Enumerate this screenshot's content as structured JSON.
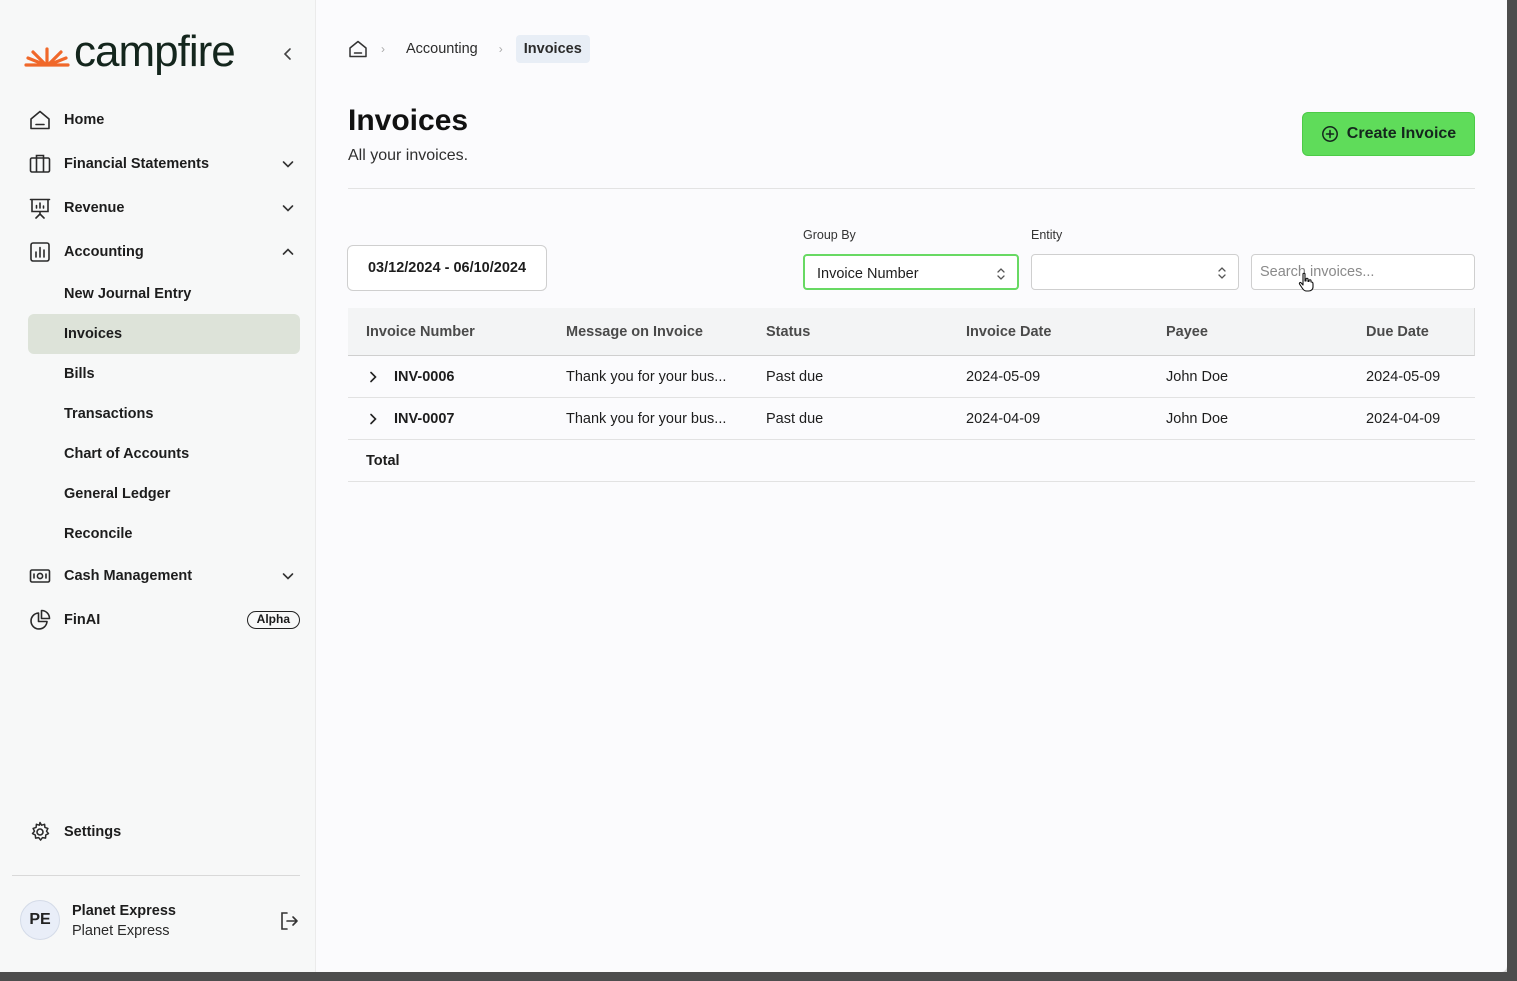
{
  "brand": {
    "name": "campfire",
    "accent": "#f0682a",
    "primary_green": "#5fdc5a"
  },
  "sidebar": {
    "items": [
      {
        "label": "Home",
        "icon": "home-icon"
      },
      {
        "label": "Financial Statements",
        "icon": "briefcase-icon",
        "expandable": true,
        "expanded": false
      },
      {
        "label": "Revenue",
        "icon": "presentation-icon",
        "expandable": true,
        "expanded": false
      },
      {
        "label": "Accounting",
        "icon": "chart-box-icon",
        "expandable": true,
        "expanded": true
      },
      {
        "label": "Cash Management",
        "icon": "cash-icon",
        "expandable": true,
        "expanded": false
      },
      {
        "label": "FinAI",
        "icon": "pie-icon",
        "badge": "Alpha"
      }
    ],
    "accounting_sub": [
      "New Journal Entry",
      "Invoices",
      "Bills",
      "Transactions",
      "Chart of Accounts",
      "General Ledger",
      "Reconcile"
    ],
    "active_sub": "Invoices",
    "settings_label": "Settings",
    "user": {
      "initials": "PE",
      "name": "Planet Express",
      "org": "Planet Express"
    }
  },
  "breadcrumb": {
    "parent": "Accounting",
    "current": "Invoices"
  },
  "page": {
    "title": "Invoices",
    "subtitle": "All your invoices.",
    "create_label": "Create Invoice"
  },
  "filters": {
    "date_range": "03/12/2024 - 06/10/2024",
    "group_by_label": "Group By",
    "group_by_value": "Invoice Number",
    "entity_label": "Entity",
    "entity_value": "",
    "search_placeholder": "Search invoices..."
  },
  "table": {
    "columns": [
      "Invoice Number",
      "Message on Invoice",
      "Status",
      "Invoice Date",
      "Payee",
      "Due Date"
    ],
    "rows": [
      {
        "number": "INV-0006",
        "message": "Thank you for your bus...",
        "status": "Past due",
        "invoice_date": "2024-05-09",
        "payee": "John Doe",
        "due_date": "2024-05-09"
      },
      {
        "number": "INV-0007",
        "message": "Thank you for your bus...",
        "status": "Past due",
        "invoice_date": "2024-04-09",
        "payee": "John Doe",
        "due_date": "2024-04-09"
      }
    ],
    "total_label": "Total"
  }
}
